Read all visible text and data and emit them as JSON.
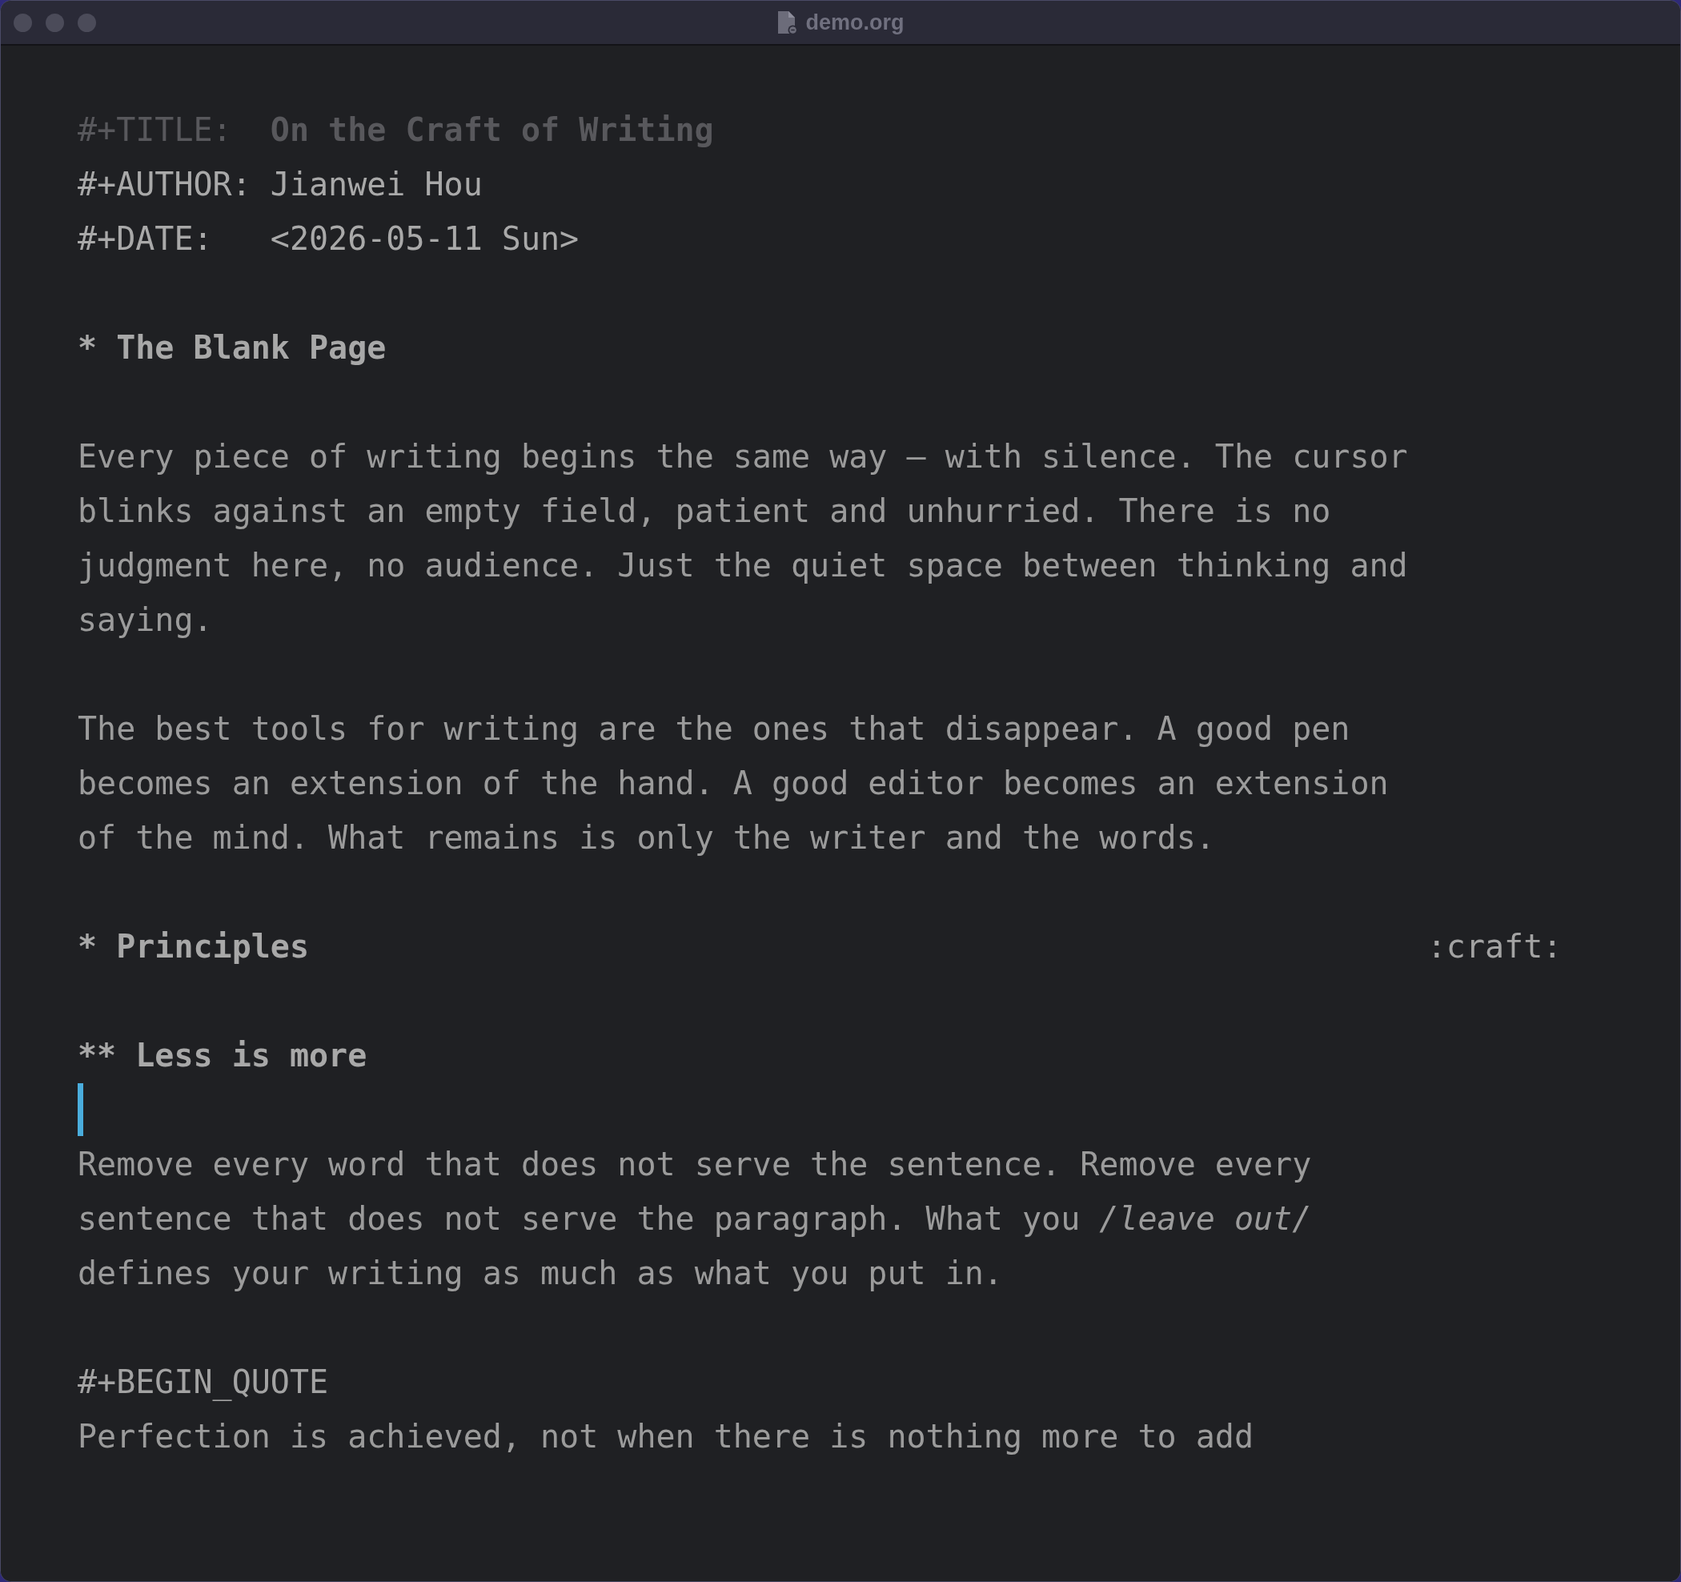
{
  "window": {
    "title": "demo.org"
  },
  "editor": {
    "lines": [
      {
        "kind": "title",
        "key": "#+TITLE:",
        "value": "On the Craft of Writing"
      },
      {
        "kind": "keyword",
        "key": "#+AUTHOR:",
        "value": "Jianwei Hou"
      },
      {
        "kind": "keyword",
        "key": "#+DATE:",
        "value": "<2026-05-11 Sun>"
      },
      {
        "kind": "blank"
      },
      {
        "kind": "heading",
        "stars": "*",
        "title": "The Blank Page"
      },
      {
        "kind": "blank"
      },
      {
        "kind": "text",
        "text": "Every piece of writing begins the same way — with silence. The cursor"
      },
      {
        "kind": "text",
        "text": "blinks against an empty field, patient and unhurried. There is no"
      },
      {
        "kind": "text",
        "text": "judgment here, no audience. Just the quiet space between thinking and"
      },
      {
        "kind": "text",
        "text": "saying."
      },
      {
        "kind": "blank"
      },
      {
        "kind": "text",
        "text": "The best tools for writing are the ones that disappear. A good pen"
      },
      {
        "kind": "text",
        "text": "becomes an extension of the hand. A good editor becomes an extension"
      },
      {
        "kind": "text",
        "text": "of the mind. What remains is only the writer and the words."
      },
      {
        "kind": "blank"
      },
      {
        "kind": "heading",
        "stars": "*",
        "title": "Principles",
        "tags": ":craft:"
      },
      {
        "kind": "blank"
      },
      {
        "kind": "heading",
        "stars": "**",
        "title": "Less is more"
      },
      {
        "kind": "cursor"
      },
      {
        "kind": "text",
        "text": "Remove every word that does not serve the sentence. Remove every"
      },
      {
        "kind": "text",
        "text": "sentence that does not serve the paragraph. What you */leave out/*"
      },
      {
        "kind": "text",
        "text": "defines your writing as much as what you put in."
      },
      {
        "kind": "blank"
      },
      {
        "kind": "block",
        "text": "#+BEGIN_QUOTE"
      },
      {
        "kind": "text",
        "text": "Perfection is achieved, not when there is nothing more to add"
      }
    ]
  }
}
